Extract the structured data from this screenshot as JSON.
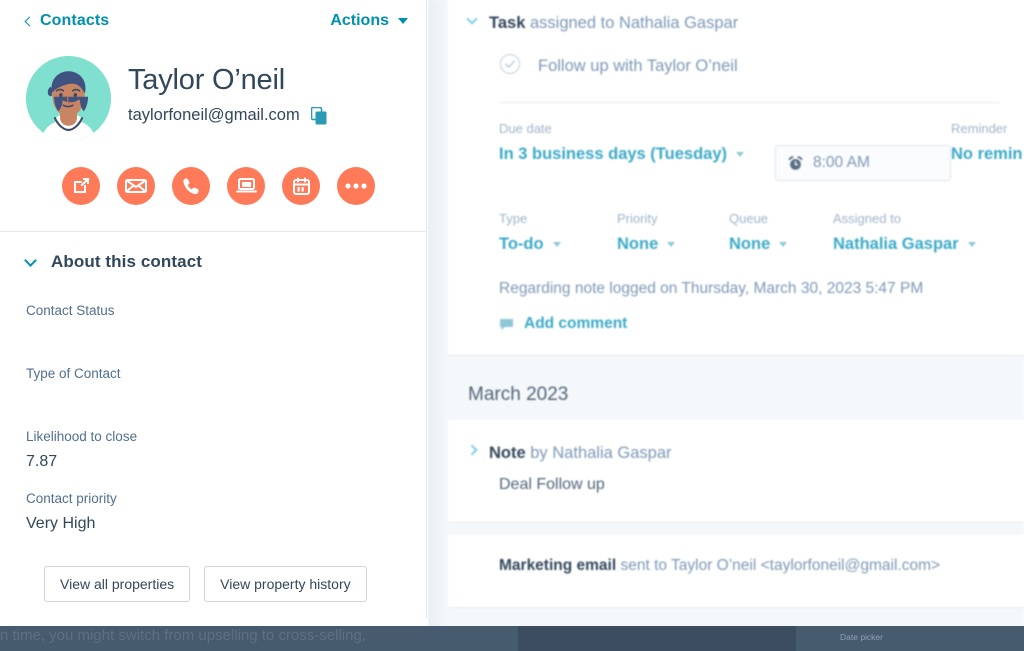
{
  "sidebar": {
    "breadcrumb_label": "Contacts",
    "actions_label": "Actions",
    "contact_name": "Taylor O’neil",
    "contact_email": "taylorfoneil@gmail.com",
    "avatar_bg": "#7fe0cf",
    "accent_orange": "#ff7a59",
    "accent_teal": "#0091ae",
    "action_buttons": [
      {
        "name": "note-button",
        "icon": "note-edit-icon"
      },
      {
        "name": "email-button",
        "icon": "envelope-icon"
      },
      {
        "name": "call-button",
        "icon": "phone-icon"
      },
      {
        "name": "meeting-button",
        "icon": "laptop-icon"
      },
      {
        "name": "task-button",
        "icon": "calendar-icon"
      },
      {
        "name": "more-button",
        "icon": "ellipsis-icon"
      }
    ],
    "about_section_title": "About this contact",
    "properties": [
      {
        "label": "Contact Status",
        "value": ""
      },
      {
        "label": "Type of Contact",
        "value": ""
      },
      {
        "label": "Likelihood to close",
        "value": "7.87"
      },
      {
        "label": "Contact priority",
        "value": "Very High"
      }
    ],
    "view_all_properties_label": "View all properties",
    "view_property_history_label": "View property history"
  },
  "timeline": {
    "task": {
      "head_bold": "Task",
      "head_rest": " assigned to Nathalia Gaspar",
      "title": "Follow up with Taylor O’neil",
      "due_date_label": "Due date",
      "due_date_value": "In 3 business days (Tuesday)",
      "due_time_value": "8:00 AM",
      "reminder_label": "Reminder",
      "reminder_value": "No remin",
      "type_label": "Type",
      "type_value": "To-do",
      "priority_label": "Priority",
      "priority_value": "None",
      "queue_label": "Queue",
      "queue_value": "None",
      "assigned_label": "Assigned to",
      "assigned_value": "Nathalia Gaspar",
      "regarding_text": "Regarding note logged on Thursday, March 30, 2023 5:47 PM",
      "add_comment_label": "Add comment"
    },
    "month_separator": "March 2023",
    "note": {
      "head_bold": "Note",
      "head_rest": " by Nathalia Gaspar",
      "body": "Deal Follow up"
    },
    "email": {
      "head_bold": "Marketing email",
      "head_rest": " sent to Taylor O’neil <taylorfoneil@gmail.com>"
    }
  },
  "bottom_bar": {
    "caption": "Date picker",
    "ghost_text": "n time, you might switch from upselling to cross-selling,",
    "bar_color": "#465b6e"
  }
}
